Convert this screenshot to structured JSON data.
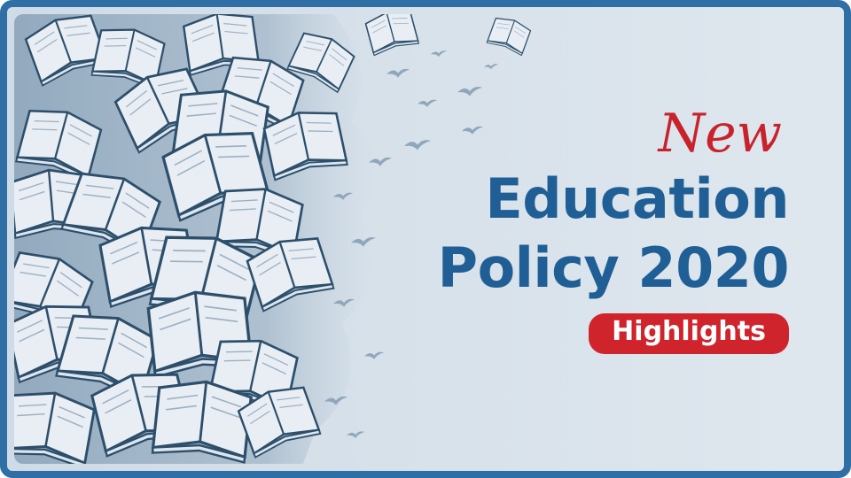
{
  "headline": {
    "new_word": "New",
    "line1": "Education",
    "line2": "Policy 2020",
    "badge_label": "Highlights"
  },
  "colors": {
    "frame": "#2f6fa6",
    "accent_red": "#c8232c",
    "title_blue": "#1f5f96",
    "badge_bg": "#d0242c",
    "badge_text": "#ffffff",
    "art_fill": "#e8eef4",
    "art_stroke": "#2d4f6b",
    "art_shadow": "#8fa7bc"
  },
  "icons": [
    "open-book-icon",
    "bird-icon"
  ]
}
